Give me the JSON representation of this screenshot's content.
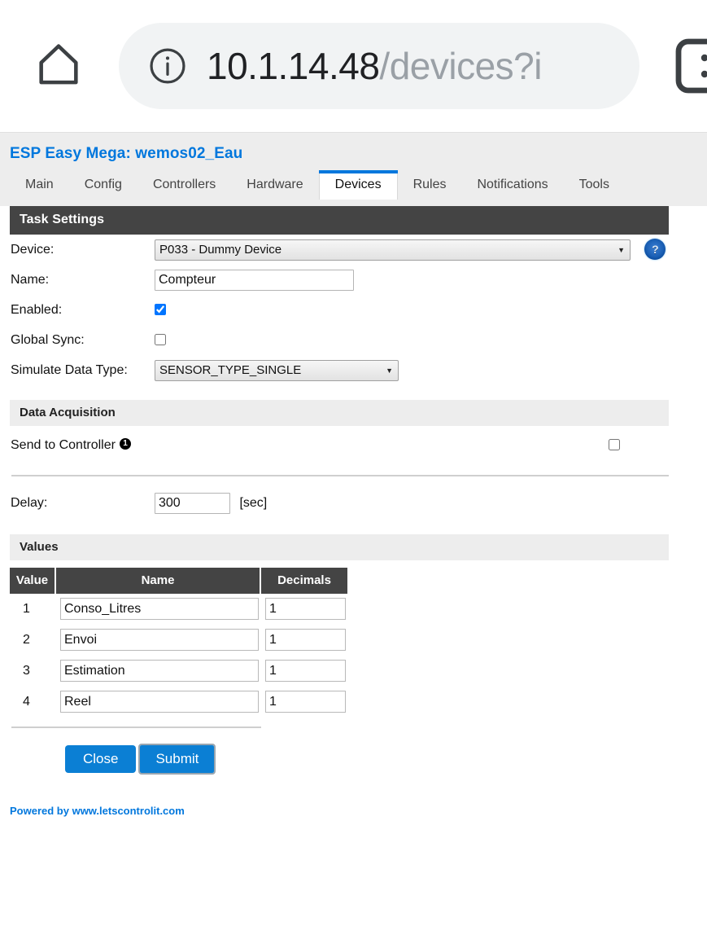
{
  "browser": {
    "home_icon": "home-icon",
    "info_icon": "info-circle-icon",
    "url_host": "10.1.14.48",
    "url_path": "/devices?i",
    "menu_icon": "three-dot-menu-icon"
  },
  "header": {
    "title": "ESP Easy Mega: wemos02_Eau",
    "title_color": "#0077DD",
    "tabs": [
      {
        "label": "Main",
        "active": false
      },
      {
        "label": "Config",
        "active": false
      },
      {
        "label": "Controllers",
        "active": false
      },
      {
        "label": "Hardware",
        "active": false
      },
      {
        "label": "Devices",
        "active": true
      },
      {
        "label": "Rules",
        "active": false
      },
      {
        "label": "Notifications",
        "active": false
      },
      {
        "label": "Tools",
        "active": false
      }
    ]
  },
  "task_settings": {
    "section_title": "Task Settings",
    "device_label": "Device:",
    "device_value": "P033 - Dummy Device",
    "help_label": "?",
    "name_label": "Name:",
    "name_value": "Compteur",
    "enabled_label": "Enabled:",
    "enabled_checked": true,
    "global_sync_label": "Global Sync:",
    "global_sync_checked": false,
    "simulate_label": "Simulate Data Type:",
    "simulate_value": "SENSOR_TYPE_SINGLE"
  },
  "data_acquisition": {
    "section_title": "Data Acquisition",
    "send_to_controller_label": "Send to Controller",
    "send_to_controller_badge": "1",
    "send_to_controller_checked": false,
    "delay_label": "Delay:",
    "delay_value": "300",
    "delay_unit": "[sec]"
  },
  "values": {
    "section_title": "Values",
    "columns": [
      "Value",
      "Name",
      "Decimals"
    ],
    "rows": [
      {
        "index": "1",
        "name": "Conso_Litres",
        "decimals": "1"
      },
      {
        "index": "2",
        "name": "Envoi",
        "decimals": "1"
      },
      {
        "index": "3",
        "name": "Estimation",
        "decimals": "1"
      },
      {
        "index": "4",
        "name": "Reel",
        "decimals": "1"
      }
    ]
  },
  "actions": {
    "close_label": "Close",
    "submit_label": "Submit",
    "button_color": "#0B7FD4"
  },
  "footer": {
    "text": "Powered by www.letscontrolit.com"
  }
}
